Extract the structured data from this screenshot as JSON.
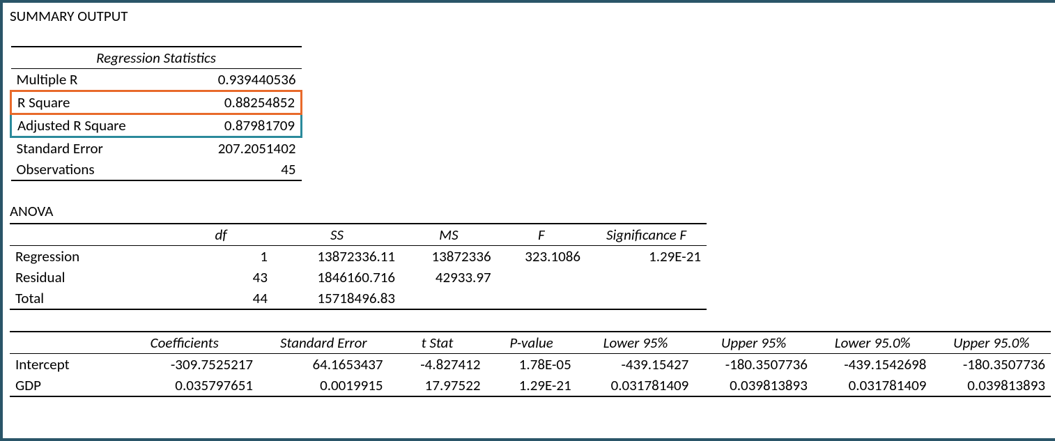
{
  "title": "SUMMARY OUTPUT",
  "regstats": {
    "header": "Regression Statistics",
    "rows": [
      {
        "label": "Multiple R",
        "value": "0.939440536"
      },
      {
        "label": "R Square",
        "value": "0.88254852"
      },
      {
        "label": "Adjusted R Square",
        "value": "0.87981709"
      },
      {
        "label": "Standard Error",
        "value": "207.2051402"
      },
      {
        "label": "Observations",
        "value": "45"
      }
    ]
  },
  "anova": {
    "title": "ANOVA",
    "headers": {
      "df": "df",
      "ss": "SS",
      "ms": "MS",
      "f": "F",
      "sig": "Significance F"
    },
    "rows": [
      {
        "label": "Regression",
        "df": "1",
        "ss": "13872336.11",
        "ms": "13872336",
        "f": "323.1086",
        "sig": "1.29E-21"
      },
      {
        "label": "Residual",
        "df": "43",
        "ss": "1846160.716",
        "ms": "42933.97",
        "f": "",
        "sig": ""
      },
      {
        "label": "Total",
        "df": "44",
        "ss": "15718496.83",
        "ms": "",
        "f": "",
        "sig": ""
      }
    ]
  },
  "coef": {
    "headers": {
      "coef": "Coefficients",
      "se": "Standard Error",
      "t": "t Stat",
      "p": "P-value",
      "l95": "Lower 95%",
      "u95": "Upper 95%",
      "l95b": "Lower 95.0%",
      "u95b": "Upper 95.0%"
    },
    "rows": [
      {
        "label": "Intercept",
        "coef": "-309.7525217",
        "se": "64.1653437",
        "t": "-4.827412",
        "p": "1.78E-05",
        "l95": "-439.15427",
        "u95": "-180.3507736",
        "l95b": "-439.1542698",
        "u95b": "-180.3507736"
      },
      {
        "label": "GDP",
        "coef": "0.035797651",
        "se": "0.0019915",
        "t": "17.97522",
        "p": "1.29E-21",
        "l95": "0.031781409",
        "u95": "0.039813893",
        "l95b": "0.031781409",
        "u95b": "0.039813893"
      }
    ]
  }
}
